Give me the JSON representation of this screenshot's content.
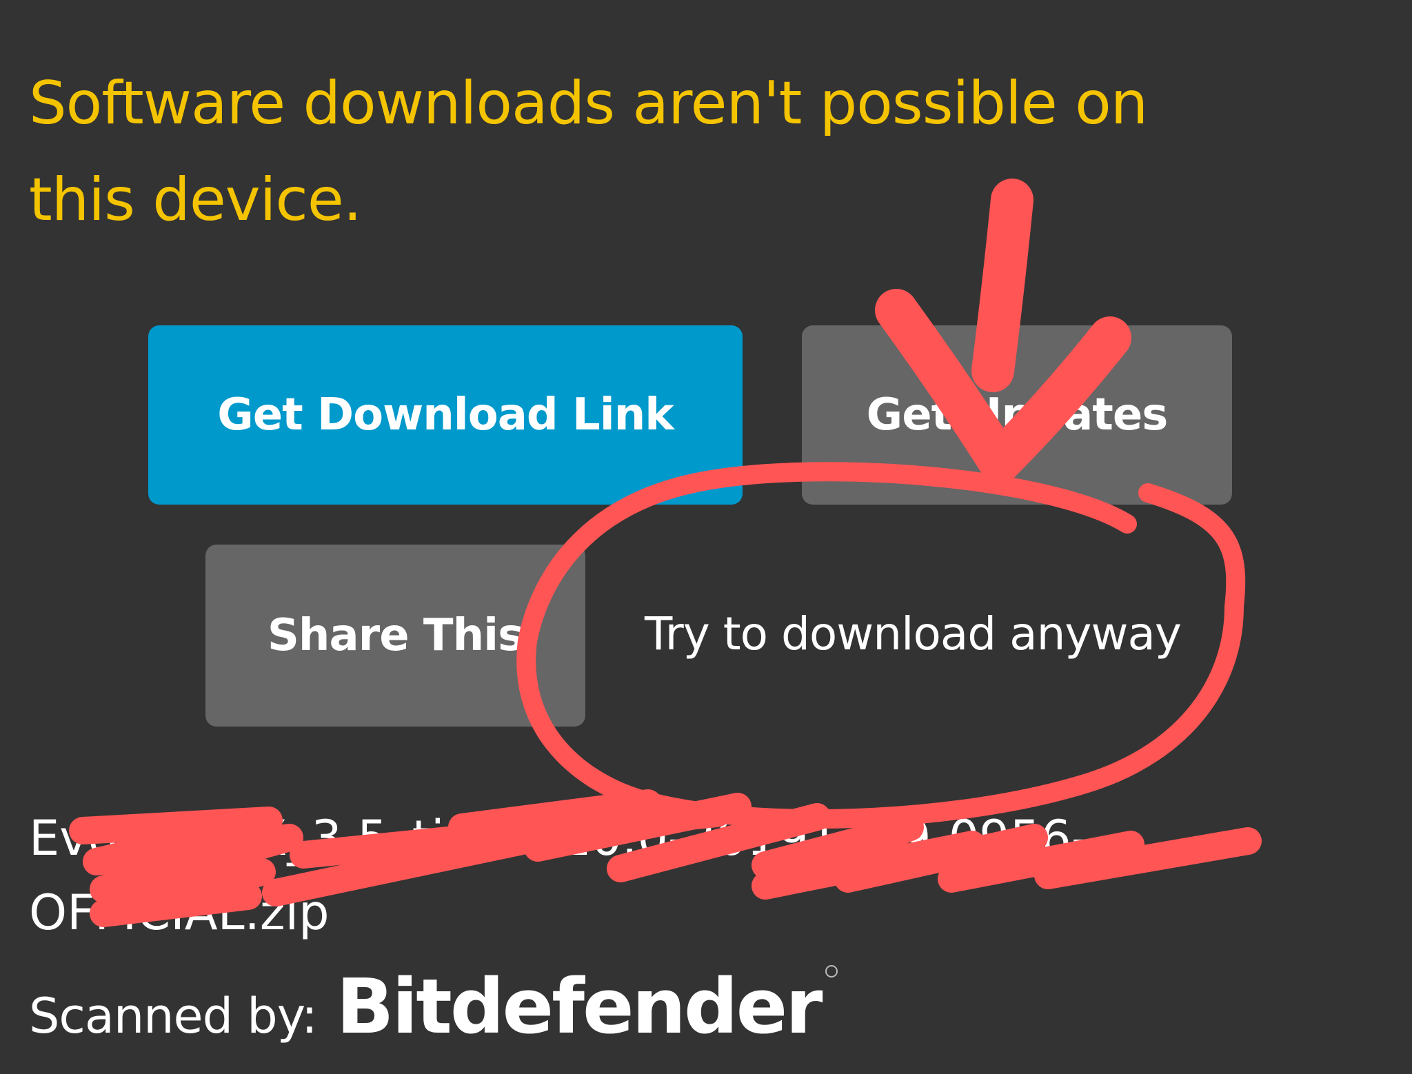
{
  "heading": {
    "line1": "Software downloads aren't possible on",
    "line2": "this device."
  },
  "buttons": {
    "get_download_link": "Get Download Link",
    "get_updates": "Get Updates",
    "share_this": "Share This"
  },
  "link": {
    "try_anyway": "Try to download anyway"
  },
  "file": {
    "name_line1": "EvolutionX_3.5_tissot-10.0-20191219-0956-",
    "name_line2": "OFFICIAL.zip"
  },
  "scan": {
    "label": "Scanned by:",
    "scanner": "Bitdefender"
  },
  "colors": {
    "background": "#333333",
    "heading": "#f5c400",
    "primary_button": "#0099cc",
    "secondary_button": "#666666",
    "annotation": "#ff5555"
  },
  "annotations": {
    "arrow_icon": "hand-drawn-down-arrow",
    "circle_icon": "hand-drawn-circle",
    "scribble_icon": "hand-drawn-redaction-scribble"
  }
}
